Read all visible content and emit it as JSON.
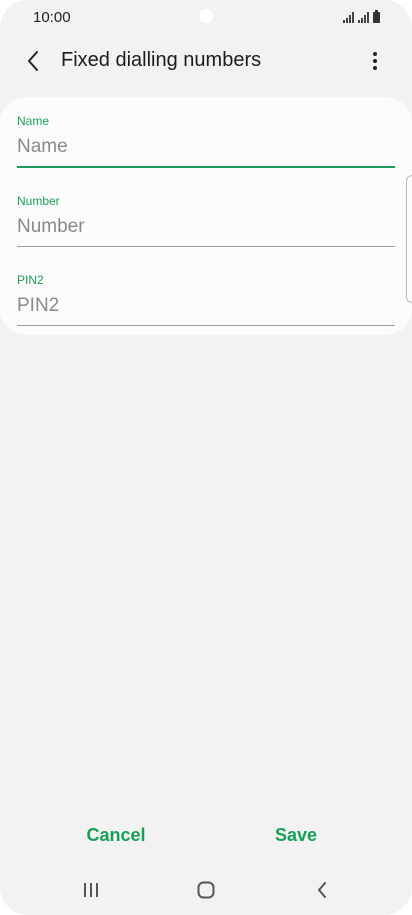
{
  "status_bar": {
    "time": "10:00",
    "icons": [
      "signal-icon",
      "signal-icon",
      "battery-icon"
    ]
  },
  "header": {
    "back_icon": "chevron-left-icon",
    "title": "Fixed dialling numbers",
    "more_icon": "more-vertical-icon"
  },
  "form": {
    "fields": [
      {
        "label": "Name",
        "placeholder": "Name",
        "value": "",
        "focused": true
      },
      {
        "label": "Number",
        "placeholder": "Number",
        "value": "",
        "focused": false
      },
      {
        "label": "PIN2",
        "placeholder": "PIN2",
        "value": "",
        "focused": false
      }
    ]
  },
  "actions": {
    "cancel_label": "Cancel",
    "save_label": "Save"
  },
  "nav_bar": {
    "recents_icon": "recents-icon",
    "home_icon": "home-icon",
    "back_icon": "back-icon"
  },
  "colors": {
    "accent": "#1a9f5a",
    "background": "#f2f2f2",
    "card": "#fcfcfc"
  }
}
